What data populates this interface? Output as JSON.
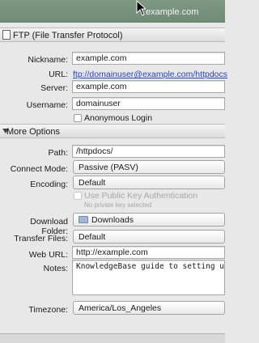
{
  "window": {
    "title": "example.com"
  },
  "ftp_section": {
    "title": "FTP (File Transfer Protocol)"
  },
  "form": {
    "nickname_label": "Nickname:",
    "nickname_value": "example.com",
    "url_label": "URL:",
    "url_value": "ftp://domainuser@example.com/httpdocs",
    "server_label": "Server:",
    "server_value": "example.com",
    "username_label": "Username:",
    "username_value": "domainuser",
    "anonymous_label": "Anonymous Login"
  },
  "more_options": {
    "title": "More Options",
    "path_label": "Path:",
    "path_value": "/httpdocs/",
    "connect_mode_label": "Connect Mode:",
    "connect_mode_value": "Passive (PASV)",
    "encoding_label": "Encoding:",
    "encoding_value": "Default",
    "public_key_label": "Use Public Key Authentication",
    "public_key_note": "No private key selected",
    "download_folder_label": "Download Folder:",
    "download_folder_value": "Downloads",
    "transfer_files_label": "Transfer Files:",
    "transfer_files_value": "Default",
    "web_url_label": "Web URL:",
    "web_url_value": "http://example.com",
    "notes_label": "Notes:",
    "notes_value": "KnowledgeBase guide to setting up Cy",
    "timezone_label": "Timezone:",
    "timezone_value": "America/Los_Angeles"
  }
}
